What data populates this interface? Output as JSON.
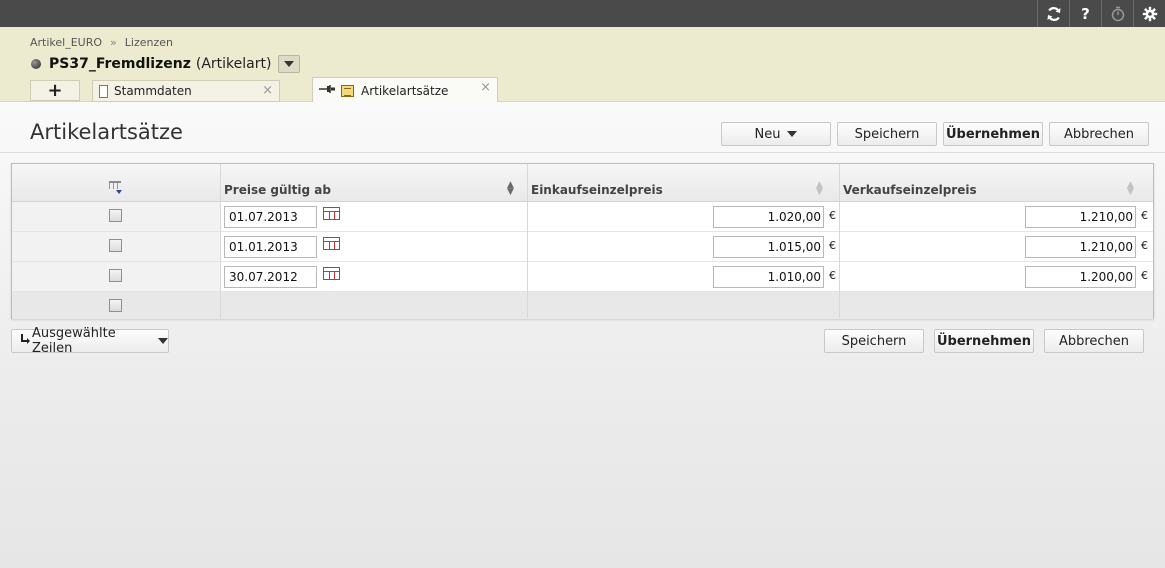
{
  "breadcrumb": [
    "Artikel_EURO",
    "Lizenzen"
  ],
  "breadcrumb_sep": "»",
  "object": {
    "name": "PS37_Fremdlizenz",
    "type": "(Artikelart)"
  },
  "tabs": {
    "add_label": "+",
    "items": [
      {
        "label": "Stammdaten",
        "icon": "page-icon",
        "active": false
      },
      {
        "label": "Artikelartsätze",
        "icon": "table-icon",
        "active": true,
        "pinned": true
      }
    ],
    "close_glyph": "×"
  },
  "topbar_icons": [
    "refresh-icon",
    "help-icon",
    "timer-icon",
    "gear-icon"
  ],
  "topbar_help_glyph": "?",
  "page_title": "Artikelartsätze",
  "toolbar": {
    "new_label": "Neu",
    "save_label": "Speichern",
    "apply_label": "Übernehmen",
    "cancel_label": "Abbrechen"
  },
  "table": {
    "columns": [
      "Preise gültig ab",
      "Einkaufseinzelpreis",
      "Verkaufseinzelpreis"
    ],
    "currency": "€",
    "rows": [
      {
        "date": "01.07.2013",
        "purchase": "1.020,00",
        "sale": "1.210,00"
      },
      {
        "date": "01.01.2013",
        "purchase": "1.015,00",
        "sale": "1.210,00"
      },
      {
        "date": "30.07.2012",
        "purchase": "1.010,00",
        "sale": "1.200,00"
      }
    ]
  },
  "footer": {
    "selected_rows_label": "Ausgewählte Zeilen",
    "save_label": "Speichern",
    "apply_label": "Übernehmen",
    "cancel_label": "Abbrechen"
  },
  "colors": {
    "header_bg": "#ecebd0",
    "topbar_bg": "#4a4a4a"
  }
}
